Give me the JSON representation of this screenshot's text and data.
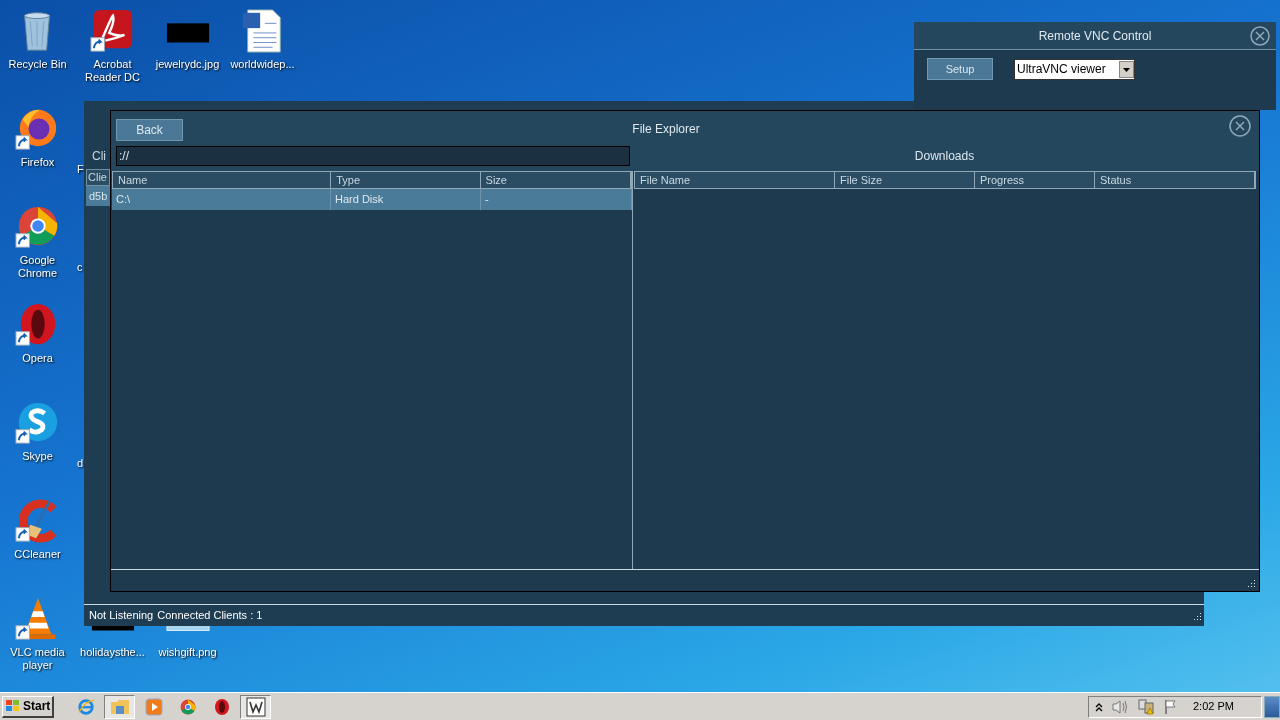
{
  "desktop_icons": [
    {
      "label": "Recycle Bin",
      "kind": "recycle"
    },
    {
      "label": "Firefox",
      "kind": "firefox"
    },
    {
      "label": "Google Chrome",
      "kind": "chrome"
    },
    {
      "label": "Opera",
      "kind": "opera"
    },
    {
      "label": "Skype",
      "kind": "skype"
    },
    {
      "label": "CCleaner",
      "kind": "ccleaner"
    },
    {
      "label": "VLC media player",
      "kind": "vlc"
    }
  ],
  "desktop_top_row": [
    {
      "label": "Acrobat Reader DC",
      "kind": "pdf"
    },
    {
      "label": "jewelrydc.jpg",
      "kind": "dark-image"
    },
    {
      "label": "worldwidep...",
      "kind": "document"
    }
  ],
  "desktop_partial_labels": [
    "F",
    "c",
    "d"
  ],
  "desktop_bottom_row": [
    {
      "label": "holidaysthe...",
      "kind": "dark-image"
    },
    {
      "label": "wishgift.png",
      "kind": "light-image"
    }
  ],
  "client_window": {
    "label": "Cli",
    "table": {
      "columns": [
        "Clie"
      ],
      "rows": [
        {
          "cells": [
            "d5b"
          ],
          "selected": true
        }
      ]
    },
    "status_bar": [
      "Not Listening",
      "Connected Clients : 1"
    ]
  },
  "vnc_window": {
    "title": "Remote VNC Control",
    "setup_button": "Setup",
    "viewer_select": "UltraVNC viewer"
  },
  "file_explorer": {
    "title": "File Explorer",
    "back_button": "Back",
    "path": "://",
    "downloads_label": "Downloads",
    "files_table": {
      "columns": [
        "Name",
        "Type",
        "Size"
      ],
      "rows": [
        {
          "cells": [
            "C:\\",
            "Hard Disk",
            "-"
          ],
          "selected": true
        }
      ]
    },
    "downloads_table": {
      "columns": [
        "File Name",
        "File Size",
        "Progress",
        "Status"
      ]
    }
  },
  "taskbar": {
    "start": "Start",
    "apps": [
      {
        "kind": "ie",
        "active": false
      },
      {
        "kind": "folder",
        "active": true
      },
      {
        "kind": "media",
        "active": false
      },
      {
        "kind": "chrome",
        "active": false
      },
      {
        "kind": "opera",
        "active": false
      },
      {
        "kind": "word",
        "active": true
      }
    ],
    "clock": "2:02 PM"
  }
}
